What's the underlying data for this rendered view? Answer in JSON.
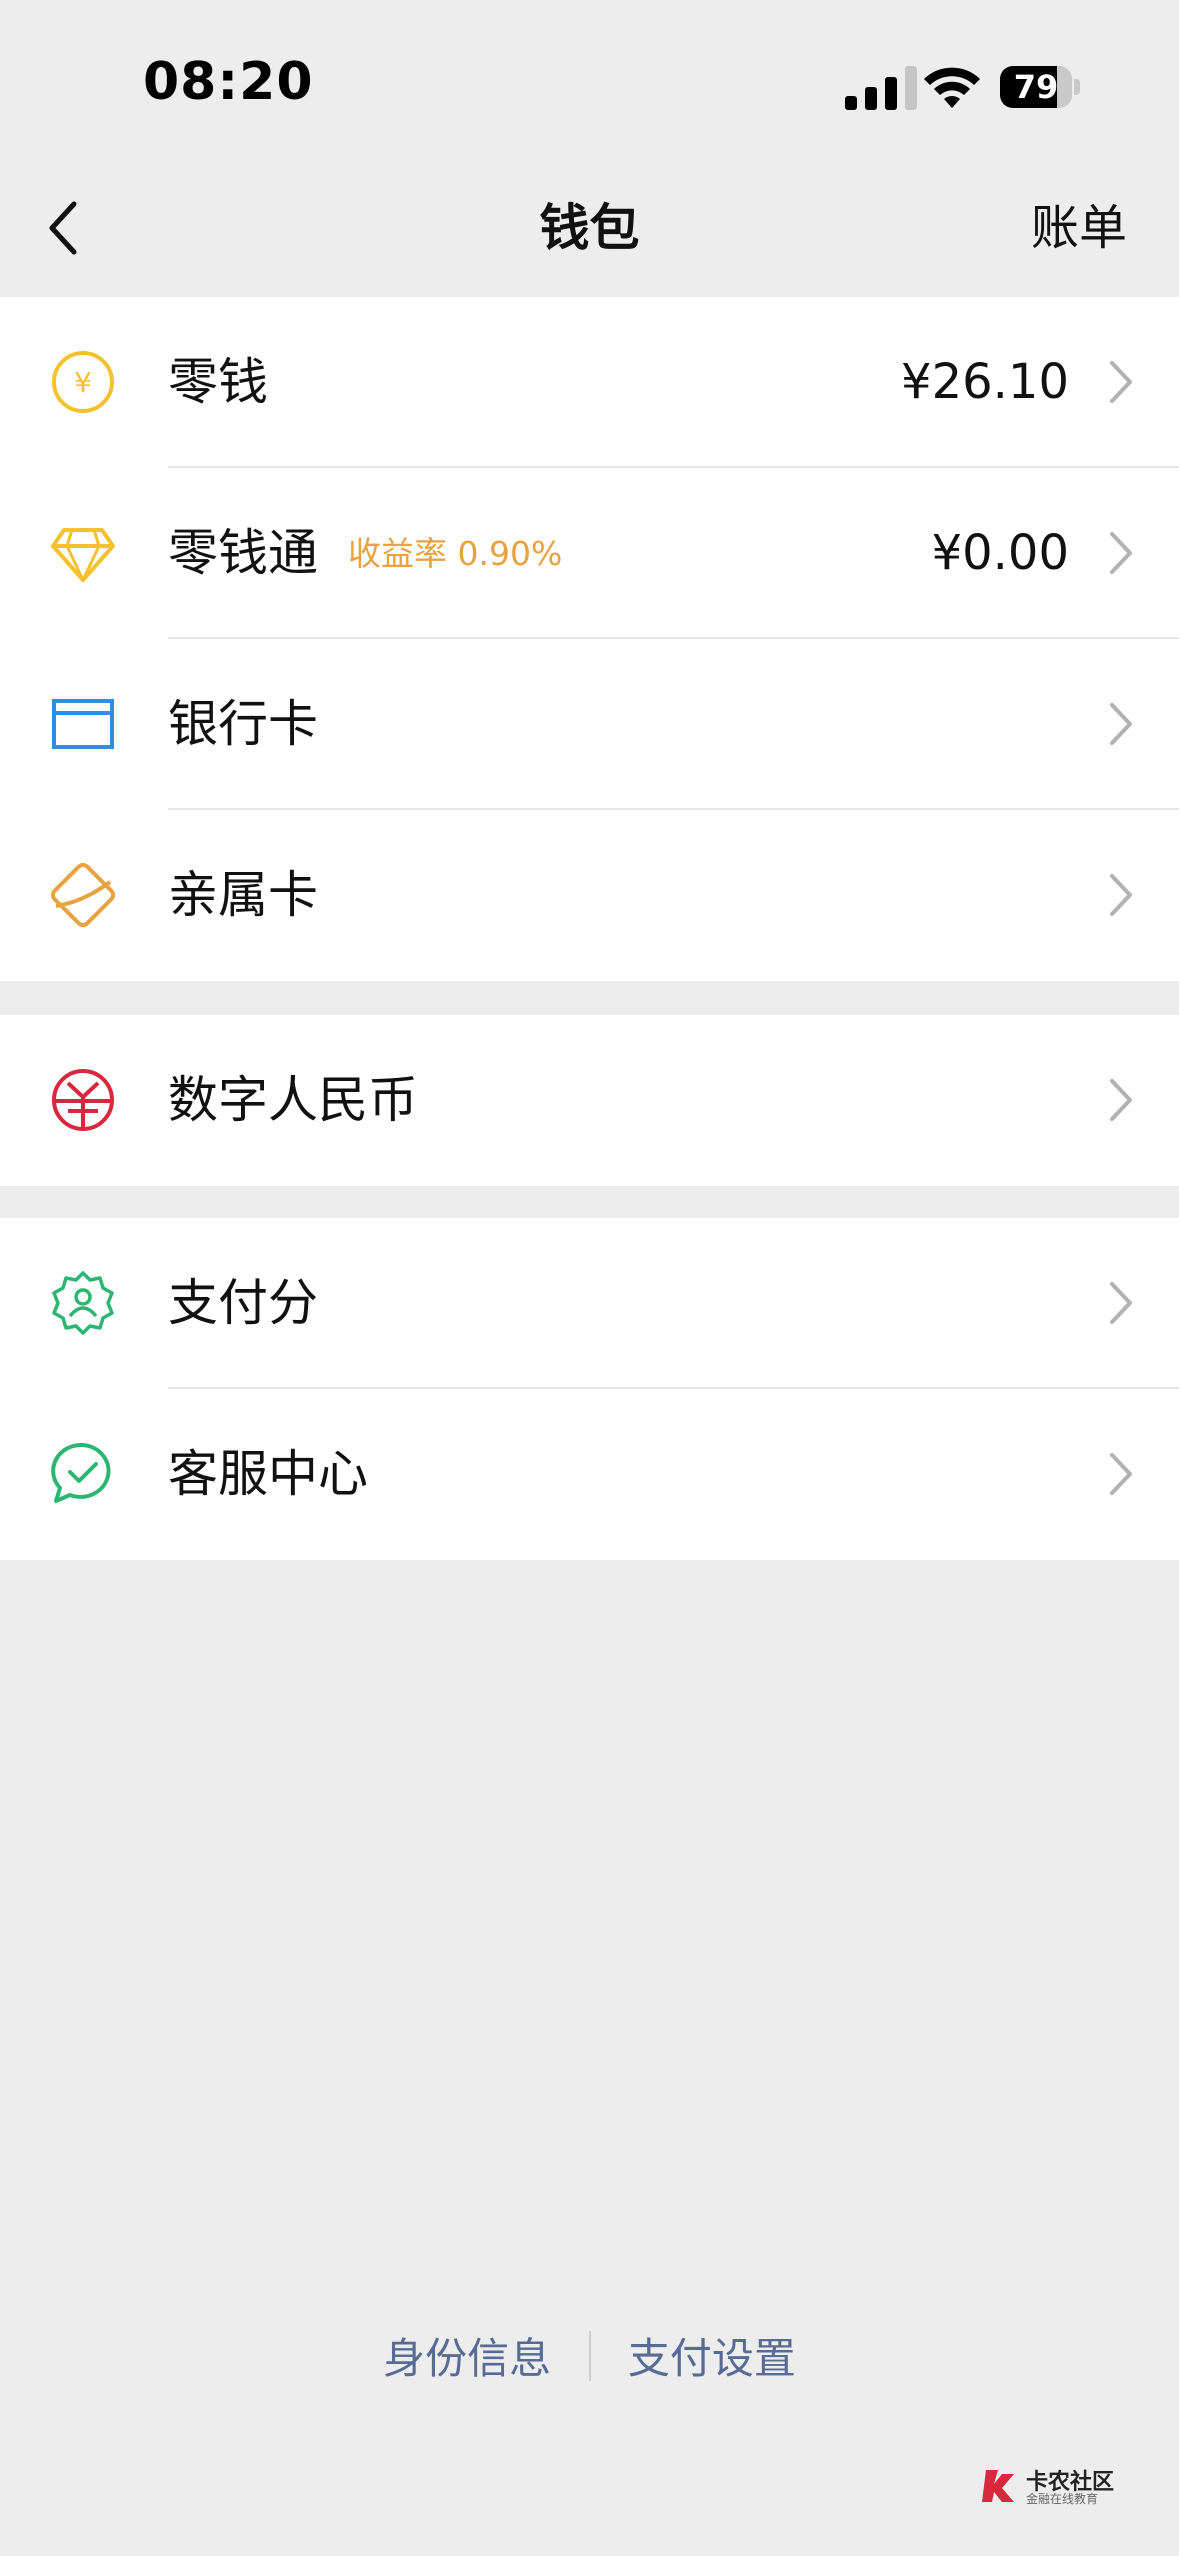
{
  "status_bar": {
    "time": "08:20",
    "battery": "79",
    "battery_level": 0.79
  },
  "nav": {
    "title": "钱包",
    "right_action": "账单"
  },
  "groups": [
    {
      "items": [
        {
          "label": "零钱",
          "value": "¥26.10",
          "icon": "coin-yuan-icon",
          "color": "#f5c12e"
        },
        {
          "label": "零钱通",
          "tag": "收益率 0.90%",
          "value": "¥0.00",
          "icon": "diamond-icon",
          "color": "#f5c12e"
        },
        {
          "label": "银行卡",
          "icon": "bank-card-icon",
          "color": "#2f8ee0"
        },
        {
          "label": "亲属卡",
          "icon": "family-card-icon",
          "color": "#e8a23e"
        }
      ]
    },
    {
      "items": [
        {
          "label": "数字人民币",
          "icon": "digital-rmb-icon",
          "color": "#d7283d"
        }
      ]
    },
    {
      "items": [
        {
          "label": "支付分",
          "icon": "pay-score-icon",
          "color": "#2bb673"
        },
        {
          "label": "客服中心",
          "icon": "customer-service-icon",
          "color": "#2bb673"
        }
      ]
    }
  ],
  "footer": {
    "identity": "身份信息",
    "pay_settings": "支付设置"
  },
  "watermark": {
    "text": "卡农社区",
    "sub": "金融在线教育"
  },
  "colors": {
    "link": "#576b95",
    "tag": "#e8a23e",
    "background": "#ededed"
  }
}
